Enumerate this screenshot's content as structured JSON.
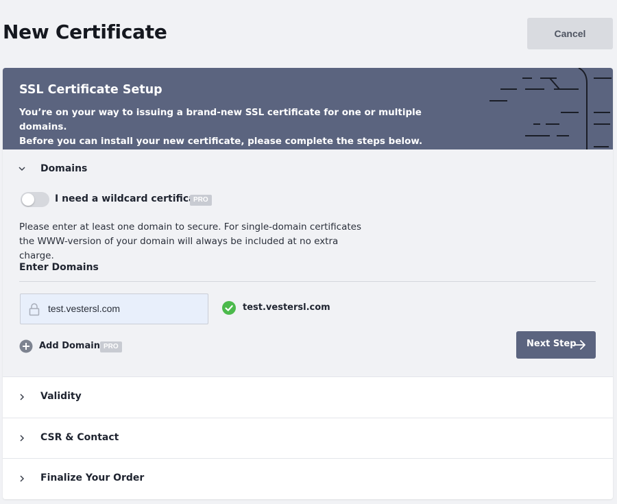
{
  "page": {
    "title": "New Certificate",
    "cancel_label": "Cancel"
  },
  "banner": {
    "title": "SSL Certificate Setup",
    "line1": "You’re on your way to issuing a brand-new SSL certificate for one or multiple domains.",
    "line2": "Before you can install your new certificate, please complete the steps below."
  },
  "domains": {
    "header": "Domains",
    "expanded": true,
    "wildcard_label": "I need a wildcard certificate",
    "wildcard_enabled": false,
    "pro_badge": "PRO",
    "info_line1": "Please enter at least one domain to secure. For single-domain certificates",
    "info_line2": "the WWW-version of your domain will always be included at no extra charge.",
    "enter_label": "Enter Domains",
    "input_value": "test.vestersl.com",
    "verified_domain": "test.vestersl.com",
    "add_label": "Add Domain",
    "next_label": "Next Step"
  },
  "steps": [
    {
      "label": "Validity"
    },
    {
      "label": "CSR & Contact"
    },
    {
      "label": "Finalize Your Order"
    }
  ],
  "colors": {
    "banner": "#5b647f",
    "accent": "#5b647f",
    "success": "#4cba4c",
    "background": "#f1f2f5"
  },
  "icons": [
    "chevron-down-icon",
    "chevron-right-icon",
    "lock-icon",
    "check-circle-icon",
    "plus-circle-icon",
    "arrow-right-icon"
  ]
}
